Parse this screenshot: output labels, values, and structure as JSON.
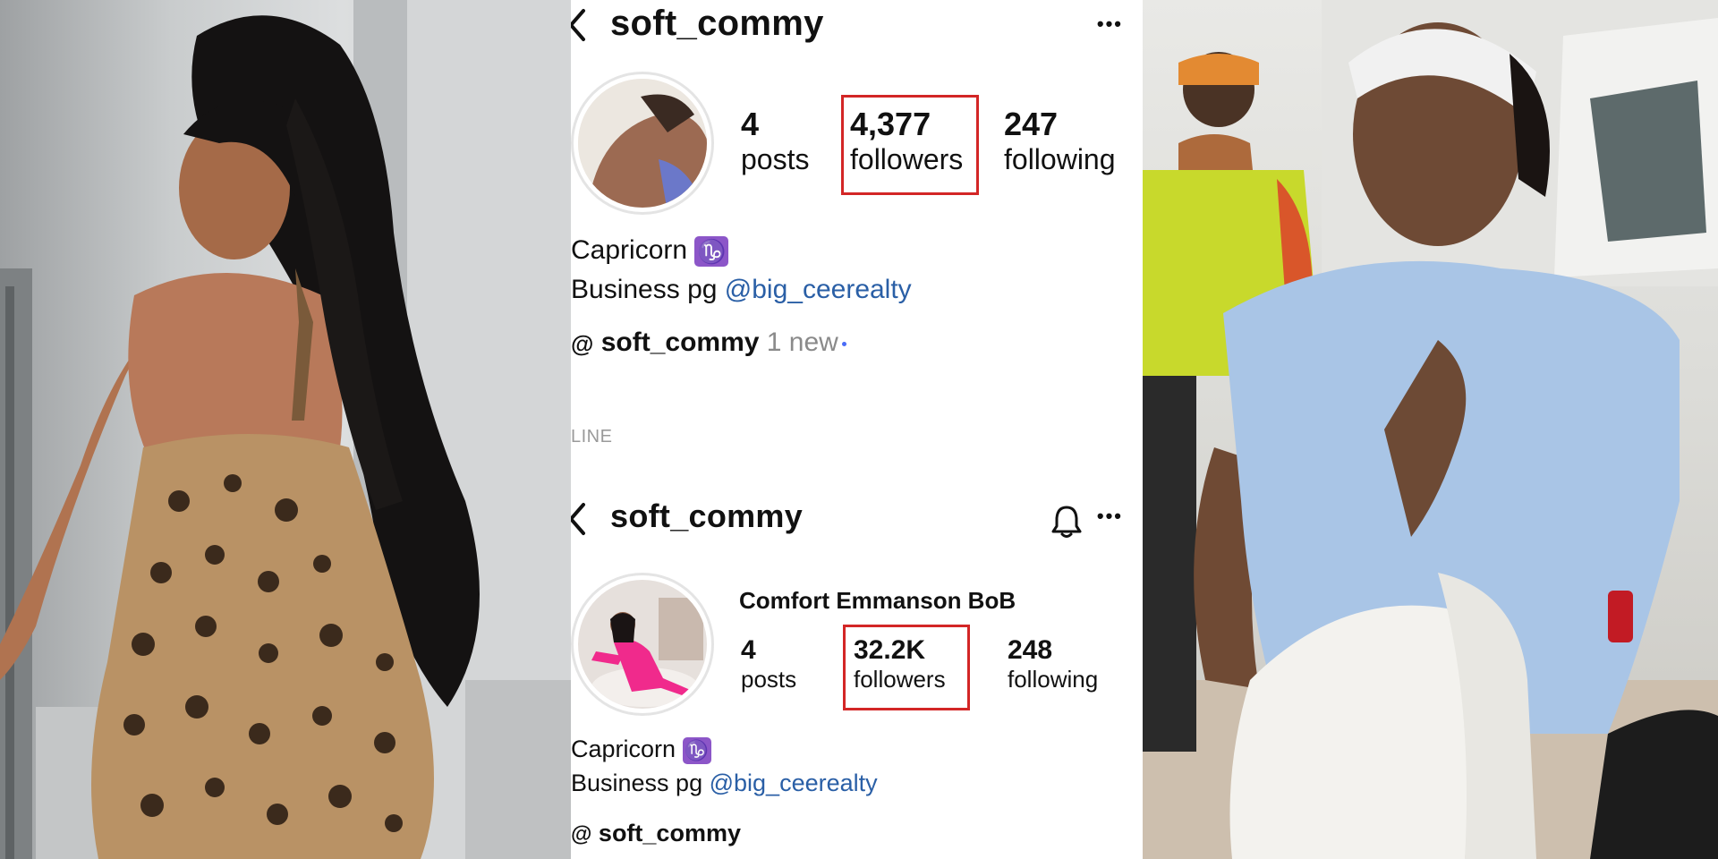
{
  "top_profile": {
    "username": "soft_commy",
    "stats": {
      "posts_count": "4",
      "posts_label": "posts",
      "followers_count": "4,377",
      "followers_label": "followers",
      "following_count": "247",
      "following_label": "following"
    },
    "bio_line1": "Capricorn",
    "zodiac_glyph": "♑",
    "bio_line2_prefix": "Business pg",
    "bio_mention": "@big_ceerealty",
    "threads_glyph": "@",
    "threads_username": "soft_commy",
    "threads_new": "1 new"
  },
  "section_label": "LINE",
  "bottom_profile": {
    "username": "soft_commy",
    "display_name": "Comfort Emmanson BoB",
    "stats": {
      "posts_count": "4",
      "posts_label": "posts",
      "followers_count": "32.2K",
      "followers_label": "followers",
      "following_count": "248",
      "following_label": "following"
    },
    "bio_line1": "Capricorn",
    "zodiac_glyph": "♑",
    "bio_line2_prefix": "Business pg",
    "bio_mention": "@big_ceerealty",
    "threads_glyph": "@",
    "threads_username": "soft_commy"
  },
  "colors": {
    "highlight_box": "#d32626",
    "mention": "#2a5fa6",
    "zodiac_badge": "#8c56c8",
    "new_dot": "#4a6cf7"
  },
  "icons": [
    "back-chevron-icon",
    "more-options-icon",
    "bell-icon",
    "threads-icon",
    "capricorn-icon"
  ]
}
